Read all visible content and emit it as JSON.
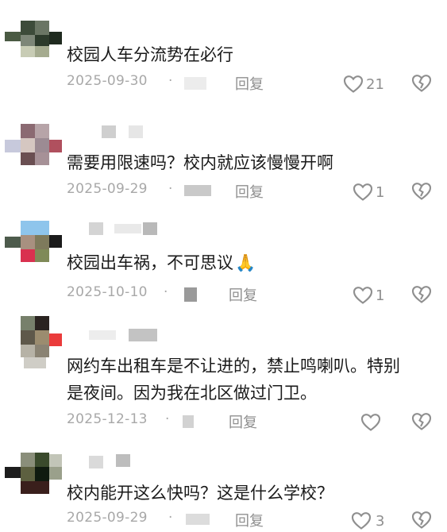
{
  "comments": [
    {
      "text": "校园人车分流势在必行",
      "date": "2025-09-30",
      "dot": "·",
      "reply": "回复",
      "likes": "21"
    },
    {
      "text": "需要用限速吗？校内就应该慢慢开啊",
      "date": "2025-09-29",
      "dot": "·",
      "reply": "回复",
      "likes": "1"
    },
    {
      "text": "校园出车祸，不可思议",
      "emoji": "🙏",
      "date": "2025-10-10",
      "dot": "·",
      "reply": "回复",
      "likes": "1"
    },
    {
      "text_line1": "网约车出租车是不让进的，禁止鸣喇叭。特别",
      "text_line2": "是夜间。因为我在北区做过门卫。",
      "date": "2025-12-13",
      "dot": "·",
      "reply": "回复",
      "likes": ""
    },
    {
      "text": "校内能开这么快吗？这是什么学校？",
      "date": "2025-09-29",
      "dot": "·",
      "reply": "回复",
      "likes": "3"
    }
  ],
  "icons": {
    "like": "heart-outline-icon",
    "dislike": "broken-heart-icon",
    "emoji": "praying-hands-emoji"
  },
  "colors": {
    "meta": "#a8a8a8",
    "text": "#1a1a1a",
    "icon": "#8f8f8f"
  }
}
